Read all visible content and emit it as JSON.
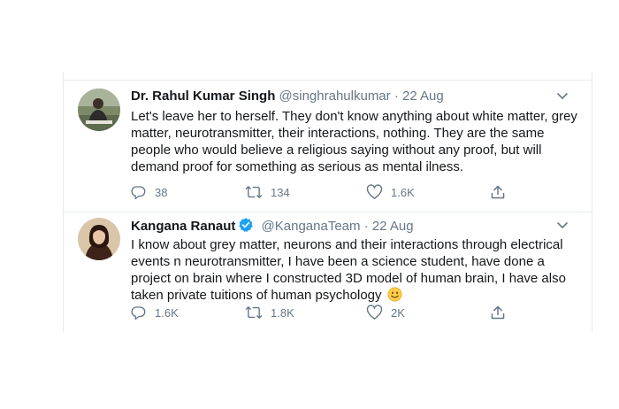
{
  "tweets": [
    {
      "author_name": "Dr. Rahul Kumar Singh",
      "handle": "@singhrahulkumar",
      "separator": "·",
      "date": "22 Aug",
      "text": "Let's leave her to herself. They don't know anything about white matter, grey matter, neurotransmitter, their interactions, nothing. They are  the same people who would believe a religious saying without any proof, but will demand proof for something as serious as mental ilness.",
      "replies": "38",
      "retweets": "134",
      "likes": "1.6K"
    },
    {
      "author_name": "Kangana Ranaut",
      "verified": true,
      "handle": "@KanganaTeam",
      "separator": "·",
      "date": "22 Aug",
      "text": "I know about grey matter, neurons and their interactions through electrical events n neurotransmitter, I have been a science student, have done a project on brain where I constructed 3D model of human brain, I have also taken private tuitions of human psychology",
      "emoji": "slightly-smiling-face",
      "replies": "1.6K",
      "retweets": "1.8K",
      "likes": "2K"
    }
  ],
  "colors": {
    "text": "#14171a",
    "secondary": "#657786",
    "verified": "#1da1f2",
    "border": "#e6ecf0"
  },
  "icons": [
    "reply-icon",
    "retweet-icon",
    "like-icon",
    "share-icon",
    "chevron-down-icon",
    "verified-badge-icon"
  ]
}
